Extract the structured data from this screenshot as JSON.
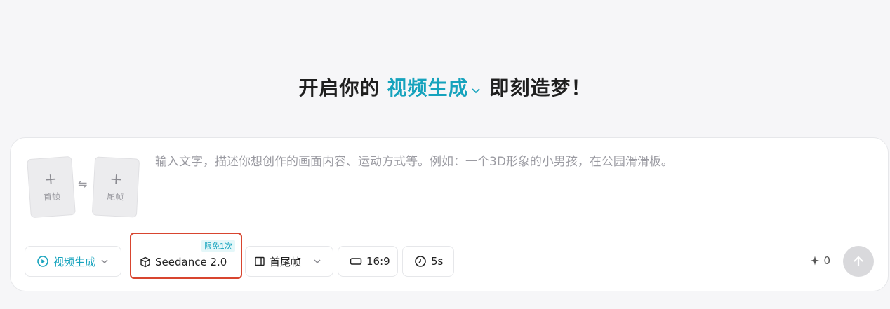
{
  "headline": {
    "prefix": "开启你的",
    "mode": "视频生成",
    "suffix": "即刻造梦！"
  },
  "upload": {
    "first_frame": "首帧",
    "last_frame": "尾帧",
    "swap_glyph": "⇋"
  },
  "prompt": {
    "placeholder": "输入文字，描述你想创作的画面内容、运动方式等。例如：一个3D形象的小男孩，在公园滑滑板。",
    "value": ""
  },
  "toolbar": {
    "mode_label": "视频生成",
    "model_label": "Seedance 2.0",
    "model_badge": "限免1次",
    "frames_label": "首尾帧",
    "ratio_label": "16:9",
    "duration_label": "5s",
    "credits": "0"
  },
  "colors": {
    "accent": "#16a3bd",
    "highlight_border": "#d8452f",
    "send_disabled": "#d9d9dc"
  },
  "icons": [
    "chevron-down-icon",
    "plus-icon",
    "swap-icon",
    "play-sparkle-icon",
    "cube-icon",
    "frame-icon",
    "aspect-ratio-icon",
    "clock-icon",
    "sparkle-icon",
    "arrow-up-icon"
  ]
}
